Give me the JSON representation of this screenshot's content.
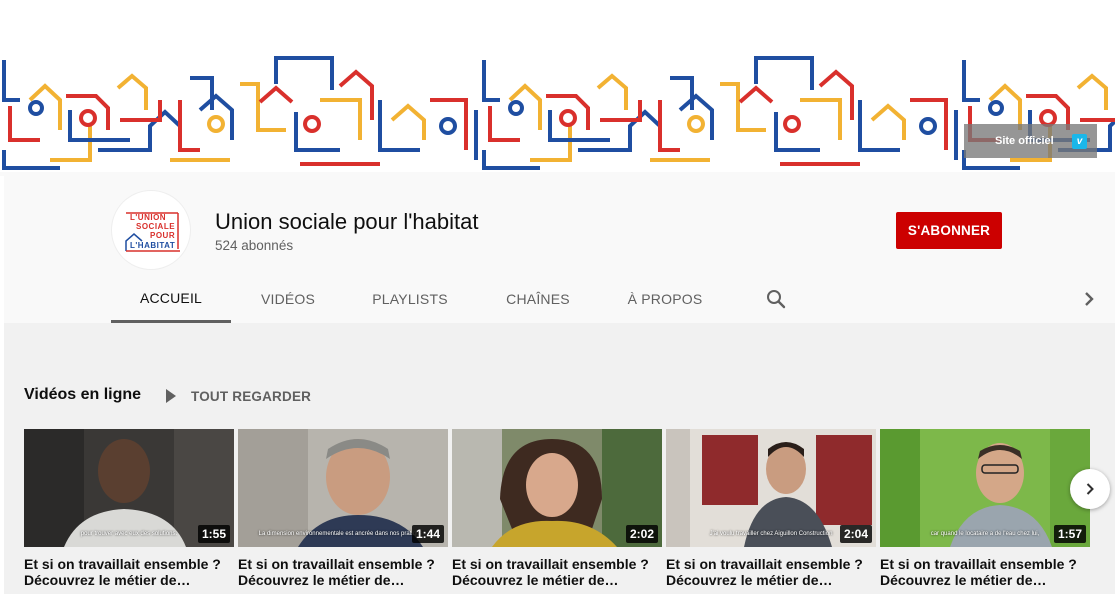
{
  "banner": {
    "site_link": "Site officiel",
    "site_icon": "vimeo-icon",
    "colors": {
      "blue": "#1f4ea1",
      "red": "#d9302c",
      "yellow": "#f2b233"
    }
  },
  "channel": {
    "name": "Union sociale pour l'habitat",
    "subscribers": "524 abonnés",
    "logo_lines": [
      "L'UNION",
      "SOCIALE",
      "POUR",
      "L'HABITAT"
    ],
    "subscribe_label": "S'ABONNER",
    "subscribe_color": "#cc0000"
  },
  "tabs": [
    {
      "label": "ACCUEIL",
      "active": true
    },
    {
      "label": "VIDÉOS"
    },
    {
      "label": "PLAYLISTS"
    },
    {
      "label": "CHAÎNES"
    },
    {
      "label": "À PROPOS"
    }
  ],
  "section": {
    "title": "Vidéos en ligne",
    "play_all": "TOUT REGARDER"
  },
  "videos": [
    {
      "duration": "1:55",
      "title_line1": "Et si on travaillait ensemble ?",
      "title_line2": "Découvrez le métier de…",
      "caption": "pour trouver avec eux des solutions."
    },
    {
      "duration": "1:44",
      "title_line1": "Et si on travaillait ensemble ?",
      "title_line2": "Découvrez le métier de…",
      "caption": "La dimension environnementale est ancrée dans nos pratiques."
    },
    {
      "duration": "2:02",
      "title_line1": "Et si on travaillait ensemble ?",
      "title_line2": "Découvrez le métier de…",
      "caption": ""
    },
    {
      "duration": "2:04",
      "title_line1": "Et si on travaillait ensemble ?",
      "title_line2": "Découvrez le métier de…",
      "caption": "J'ai voulu travailler chez Aiguillon Construction"
    },
    {
      "duration": "1:57",
      "title_line1": "Et si on travaillait ensemble ?",
      "title_line2": "Découvrez le métier de…",
      "caption": "car quand le locataire a de l'eau chez lui,"
    }
  ]
}
